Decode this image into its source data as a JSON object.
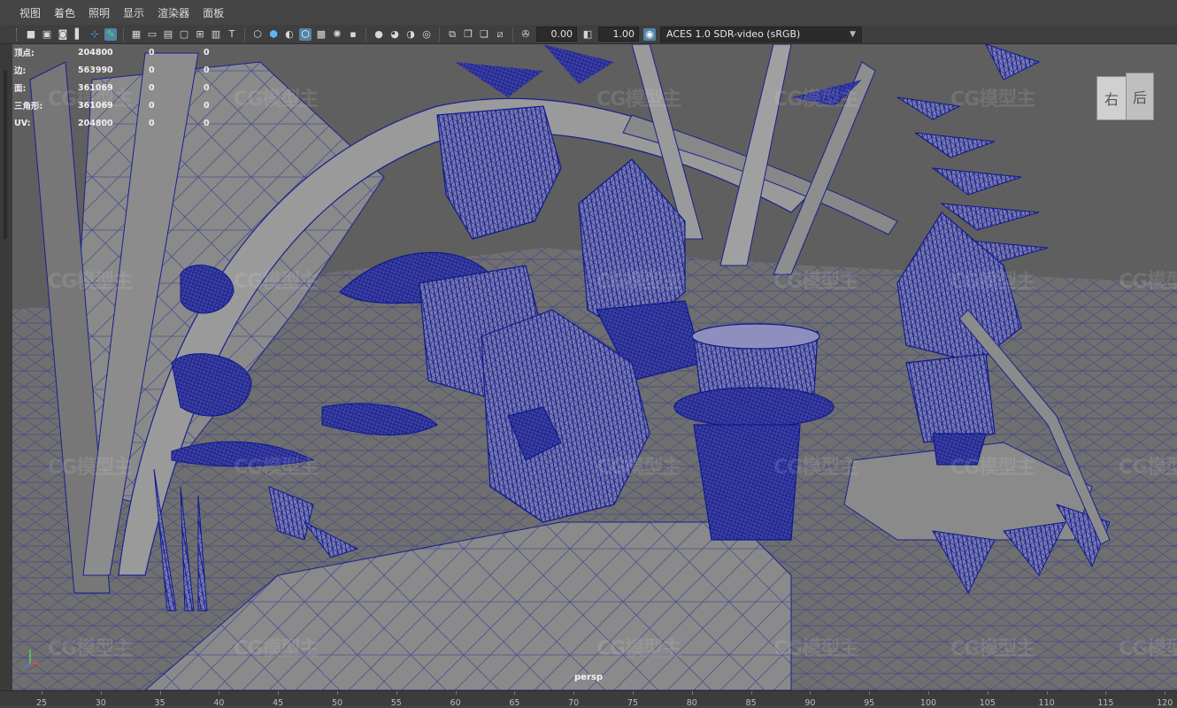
{
  "menu": [
    "视图",
    "着色",
    "照明",
    "显示",
    "渲染器",
    "面板"
  ],
  "toolbar": {
    "exposure_value": "0.00",
    "gamma_value": "1.00",
    "color_space": "ACES 1.0 SDR-video (sRGB)",
    "icons_left": [
      "camera-icon",
      "camera-attr-icon",
      "bookmark-icon",
      "image-plane-icon",
      "2d-pan-icon",
      "grease-pencil-icon"
    ],
    "icons_mid": [
      "grid-icon",
      "film-gate-icon",
      "resolution-gate-icon",
      "gate-mask-icon",
      "field-chart-icon",
      "safe-action-icon",
      "safe-title-icon"
    ],
    "icons_shade": [
      "wireframe-icon",
      "smooth-shade-icon",
      "default-material-icon",
      "wireframe-on-shaded-icon",
      "textured-icon",
      "use-all-lights-icon",
      "shadows-icon"
    ],
    "icons_render": [
      "screen-space-ao-icon",
      "motion-blur-icon",
      "anti-aliasing-icon",
      "depth-of-field-icon"
    ],
    "icons_view": [
      "isolate-select-icon",
      "xray-icon",
      "xray-joints-icon",
      "xray-components-icon"
    ]
  },
  "hud": {
    "rows": [
      {
        "label": "顶点:",
        "value": "204800",
        "c1": "0",
        "c2": "0"
      },
      {
        "label": "边:",
        "value": "563990",
        "c1": "0",
        "c2": "0"
      },
      {
        "label": "面:",
        "value": "361069",
        "c1": "0",
        "c2": "0"
      },
      {
        "label": "三角形:",
        "value": "361069",
        "c1": "0",
        "c2": "0"
      },
      {
        "label": "UV:",
        "value": "204800",
        "c1": "0",
        "c2": "0"
      }
    ]
  },
  "viewcube": {
    "face_right": "右",
    "face_back": "后"
  },
  "camera_label": "persp",
  "watermark": "CG模型主",
  "timeline": {
    "ticks": [
      "25",
      "30",
      "35",
      "40",
      "45",
      "50",
      "55",
      "60",
      "65",
      "70",
      "75",
      "80",
      "85",
      "90",
      "95",
      "100",
      "105",
      "110",
      "115",
      "120"
    ]
  },
  "colors": {
    "wire": "#0f1a8a",
    "background": "#6d6d6d",
    "accent": "#5285a6"
  }
}
